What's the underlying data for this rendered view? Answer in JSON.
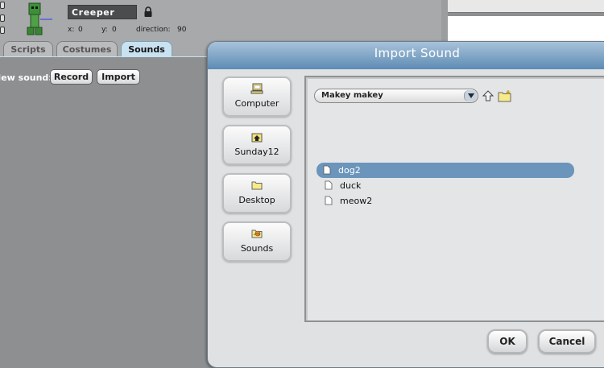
{
  "sprite": {
    "name": "Creeper",
    "x_label": "x:",
    "x_value": "0",
    "y_label": "y:",
    "y_value": "0",
    "direction_label": "direction:",
    "direction_value": "90"
  },
  "tabs": [
    {
      "label": "Scripts",
      "active": false
    },
    {
      "label": "Costumes",
      "active": false
    },
    {
      "label": "Sounds",
      "active": true
    }
  ],
  "sounds_area": {
    "new_sound_label": "New sound:",
    "record_label": "Record",
    "import_label": "Import"
  },
  "dialog": {
    "title": "Import Sound",
    "places": [
      {
        "label": "Computer",
        "icon": "computer-icon"
      },
      {
        "label": "Sunday12",
        "icon": "home-icon"
      },
      {
        "label": "Desktop",
        "icon": "folder-icon"
      },
      {
        "label": "Sounds",
        "icon": "sounds-folder-icon"
      }
    ],
    "folder_selector": {
      "value": "Makey makey"
    },
    "files": [
      {
        "name": "dog2",
        "selected": true
      },
      {
        "name": "duck",
        "selected": false
      },
      {
        "name": "meow2",
        "selected": false
      }
    ],
    "ok_label": "OK",
    "cancel_label": "Cancel"
  },
  "colors": {
    "title_bar_top": "#a8c3da",
    "title_bar_bottom": "#5d8bb4",
    "selection": "#6b95ba",
    "active_tab": "#c9e2f2"
  }
}
